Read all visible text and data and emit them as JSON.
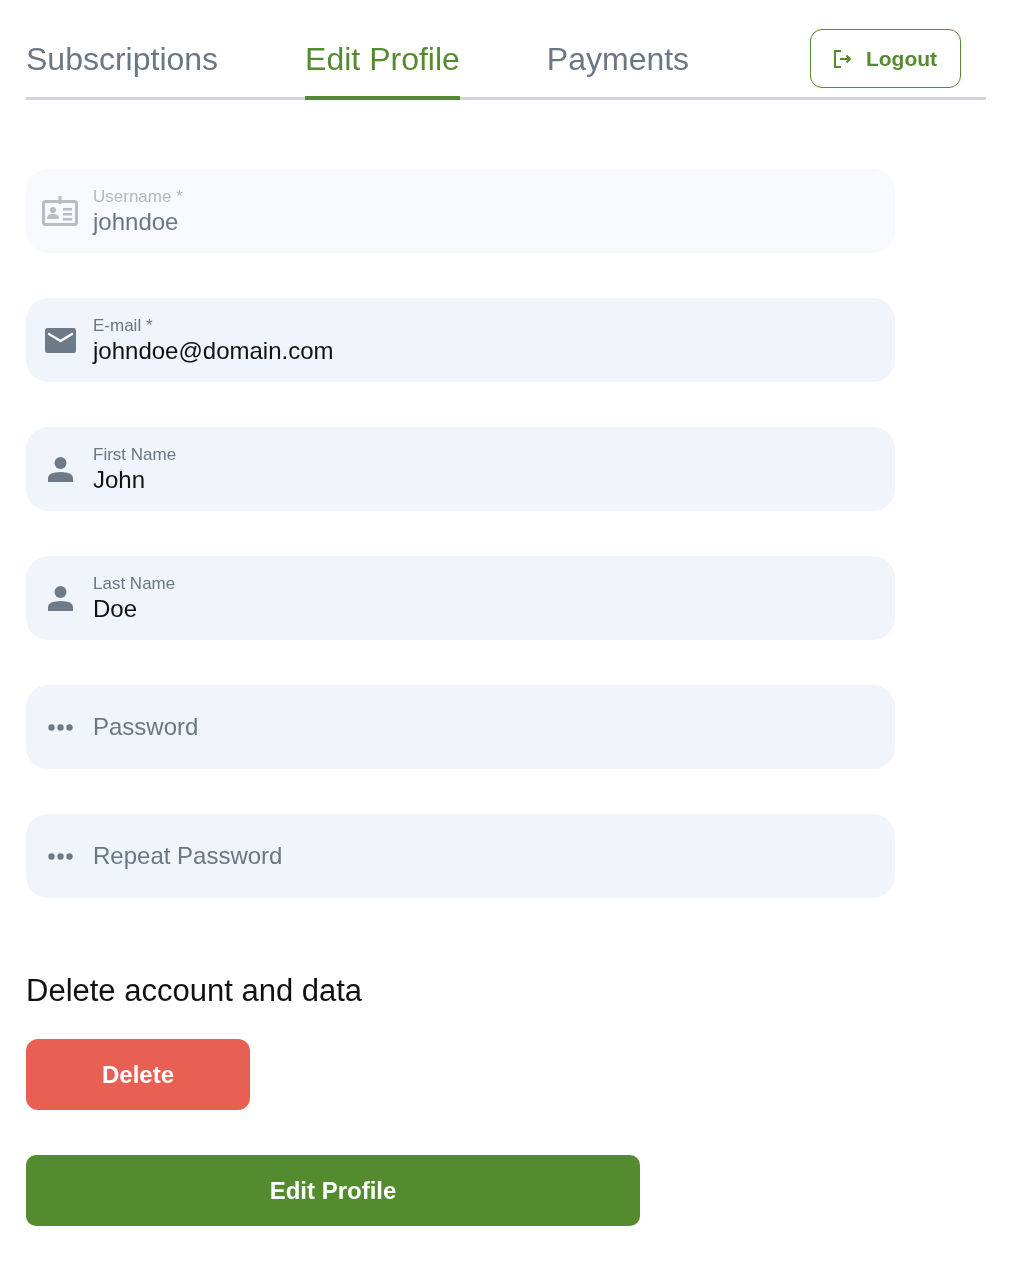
{
  "tabs": [
    {
      "label": "Subscriptions",
      "selected": false
    },
    {
      "label": "Edit Profile",
      "selected": true
    },
    {
      "label": "Payments",
      "selected": false
    }
  ],
  "logout_button": {
    "label": "Logout"
  },
  "fields": [
    {
      "kind": "id-card",
      "label": "Username *",
      "value": "johndoe",
      "disabled": true
    },
    {
      "kind": "envelope",
      "label": "E-mail *",
      "value": "johndoe@domain.com",
      "disabled": false
    },
    {
      "kind": "person",
      "label": "First Name",
      "value": "John",
      "disabled": false
    },
    {
      "kind": "person",
      "label": "Last Name",
      "value": "Doe",
      "disabled": false
    },
    {
      "kind": "dots",
      "placeholder": "Password",
      "disabled": false
    },
    {
      "kind": "dots",
      "placeholder": "Repeat Password",
      "disabled": false
    }
  ],
  "delete_section": {
    "heading": "Delete account and data",
    "button": "Delete"
  },
  "submit_button": {
    "label": "Edit Profile"
  }
}
